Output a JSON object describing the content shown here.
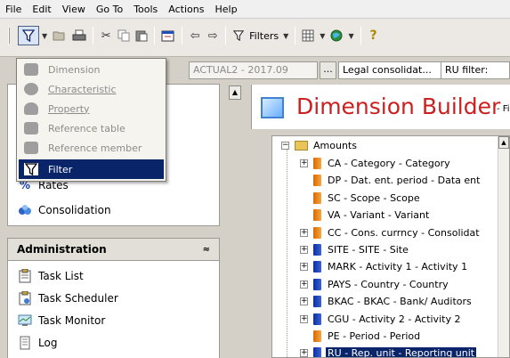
{
  "menubar": {
    "items": [
      "File",
      "Edit",
      "View",
      "Go To",
      "Tools",
      "Actions",
      "Help"
    ]
  },
  "toolbar": {
    "filters_label": "Filters"
  },
  "context": {
    "category": "ACTUAL2 - 2017.09",
    "browse": "...",
    "consolidation": "Legal consolidat...",
    "ru_filter": "RU filter:"
  },
  "dropdown": {
    "items": [
      "Dimension",
      "Characteristic",
      "Property",
      "Reference table",
      "Reference member",
      "Filter"
    ]
  },
  "left_panel": {
    "items": [
      "Rates",
      "Consolidation"
    ],
    "admin_title": "Administration",
    "admin_items": [
      "Task List",
      "Task Scheduler",
      "Task Monitor",
      "Log"
    ]
  },
  "builder": {
    "title": "Dimension Builder",
    "subtitle": "- Filt"
  },
  "tree": {
    "root": "Amounts",
    "nodes": [
      {
        "label": "CA - Category - Category",
        "color": "orange",
        "expandable": true
      },
      {
        "label": "DP - Dat. ent. period - Data ent",
        "color": "orange",
        "expandable": false
      },
      {
        "label": "SC - Scope - Scope",
        "color": "orange",
        "expandable": false
      },
      {
        "label": "VA - Variant - Variant",
        "color": "orange",
        "expandable": false
      },
      {
        "label": "CC - Cons. currncy - Consolidat",
        "color": "orange",
        "expandable": true
      },
      {
        "label": "SITE - SITE - Site",
        "color": "blue",
        "expandable": true
      },
      {
        "label": "MARK - Activity 1 - Activity 1",
        "color": "blue",
        "expandable": true
      },
      {
        "label": "PAYS - Country - Country",
        "color": "blue",
        "expandable": true
      },
      {
        "label": "BKAC - BKAC - Bank/ Auditors",
        "color": "blue",
        "expandable": true
      },
      {
        "label": "CGU - Activity 2 - Activity 2",
        "color": "blue",
        "expandable": true
      },
      {
        "label": "PE - Period - Period",
        "color": "orange",
        "expandable": false
      },
      {
        "label": "RU - Rep. unit - Reporting unit",
        "color": "blue",
        "expandable": true,
        "selected": true
      }
    ]
  }
}
